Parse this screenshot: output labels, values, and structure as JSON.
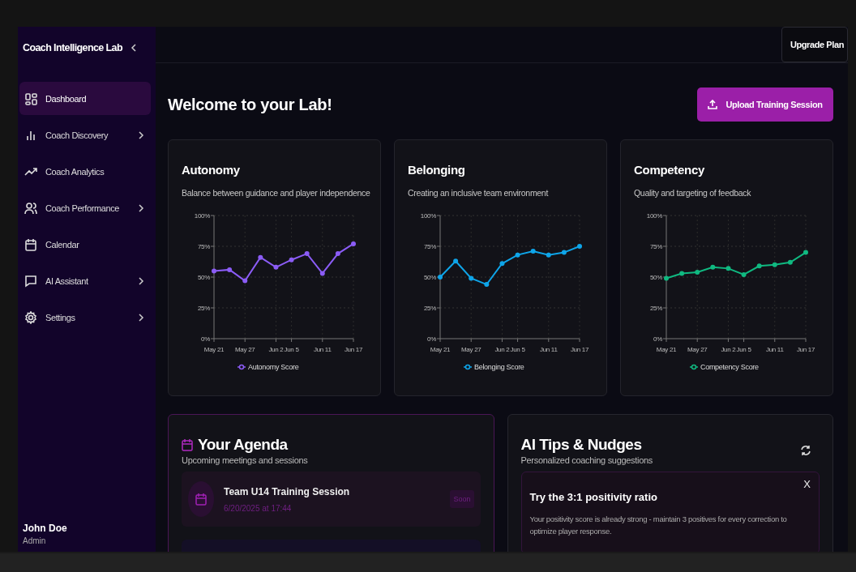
{
  "sidebar": {
    "title": "Coach Intelligence Lab",
    "items": [
      {
        "label": "Dashboard",
        "selected": true,
        "expandable": false
      },
      {
        "label": "Coach Discovery",
        "selected": false,
        "expandable": true
      },
      {
        "label": "Coach Analytics",
        "selected": false,
        "expandable": false
      },
      {
        "label": "Coach Performance",
        "selected": false,
        "expandable": true
      },
      {
        "label": "Calendar",
        "selected": false,
        "expandable": false
      },
      {
        "label": "AI Assistant",
        "selected": false,
        "expandable": true
      },
      {
        "label": "Settings",
        "selected": false,
        "expandable": true
      }
    ],
    "user": {
      "name": "John Doe",
      "role": "Admin"
    }
  },
  "topbar": {
    "upgrade_button": "Upgrade Plan"
  },
  "heading": "Welcome to your Lab!",
  "upload_button": "Upload Training Session",
  "metric_cards": [
    {
      "title": "Autonomy",
      "subtitle": "Balance between guidance and player independence",
      "chart_data": {
        "type": "line",
        "grid": true,
        "categories": [
          "May 21",
          null,
          "May 27",
          null,
          "Jun 2",
          "Jun 5",
          null,
          "Jun 11",
          null,
          "Jun 17"
        ],
        "ylim": [
          0,
          100
        ],
        "yticks": [
          {
            "value": 0,
            "label": "0%"
          },
          {
            "value": 25,
            "label": "25%"
          },
          {
            "value": 50,
            "label": "50%"
          },
          {
            "value": 75,
            "label": "75%"
          },
          {
            "value": 100,
            "label": "100%"
          }
        ],
        "series": [
          {
            "name": "Autonomy Score",
            "color": "#8b5cf6",
            "marker": "circle",
            "values": [
              55,
              56,
              47,
              66,
              58,
              64,
              69,
              53,
              69,
              77
            ]
          }
        ]
      }
    },
    {
      "title": "Belonging",
      "subtitle": "Creating an inclusive team environment",
      "chart_data": {
        "type": "line",
        "grid": true,
        "categories": [
          "May 21",
          null,
          "May 27",
          null,
          "Jun 2",
          "Jun 5",
          null,
          "Jun 11",
          null,
          "Jun 17"
        ],
        "ylim": [
          0,
          100
        ],
        "yticks": [
          {
            "value": 0,
            "label": "0%"
          },
          {
            "value": 25,
            "label": "25%"
          },
          {
            "value": 50,
            "label": "50%"
          },
          {
            "value": 75,
            "label": "75%"
          },
          {
            "value": 100,
            "label": "100%"
          }
        ],
        "series": [
          {
            "name": "Belonging Score",
            "color": "#0ea5e9",
            "marker": "circle",
            "values": [
              50,
              63,
              49,
              44,
              61,
              68,
              71,
              68,
              70,
              75
            ]
          }
        ]
      }
    },
    {
      "title": "Competency",
      "subtitle": "Quality and targeting of feedback",
      "chart_data": {
        "type": "line",
        "grid": true,
        "categories": [
          "May 21",
          null,
          "May 27",
          null,
          "Jun 2",
          "Jun 5",
          null,
          "Jun 11",
          null,
          "Jun 17"
        ],
        "ylim": [
          0,
          100
        ],
        "yticks": [
          {
            "value": 0,
            "label": "0%"
          },
          {
            "value": 25,
            "label": "25%"
          },
          {
            "value": 50,
            "label": "50%"
          },
          {
            "value": 75,
            "label": "75%"
          },
          {
            "value": 100,
            "label": "100%"
          }
        ],
        "series": [
          {
            "name": "Competency Score",
            "color": "#10b981",
            "marker": "circle",
            "values": [
              49,
              53,
              54,
              58,
              57,
              52,
              59,
              60,
              62,
              70
            ]
          }
        ]
      }
    }
  ],
  "agenda": {
    "title": "Your Agenda",
    "subtitle": "Upcoming meetings and sessions",
    "items": [
      {
        "title": "Team U14 Training Session",
        "when": "6/20/2025 at 17:44",
        "badge": "Soon"
      }
    ]
  },
  "tips": {
    "title": "AI Tips & Nudges",
    "subtitle": "Personalized coaching suggestions",
    "items": [
      {
        "close": "X",
        "title": "Try the 3:1 positivity ratio",
        "text": "Your positivity score is already strong - maintain 3 positives for every correction to optimize player response."
      }
    ]
  }
}
